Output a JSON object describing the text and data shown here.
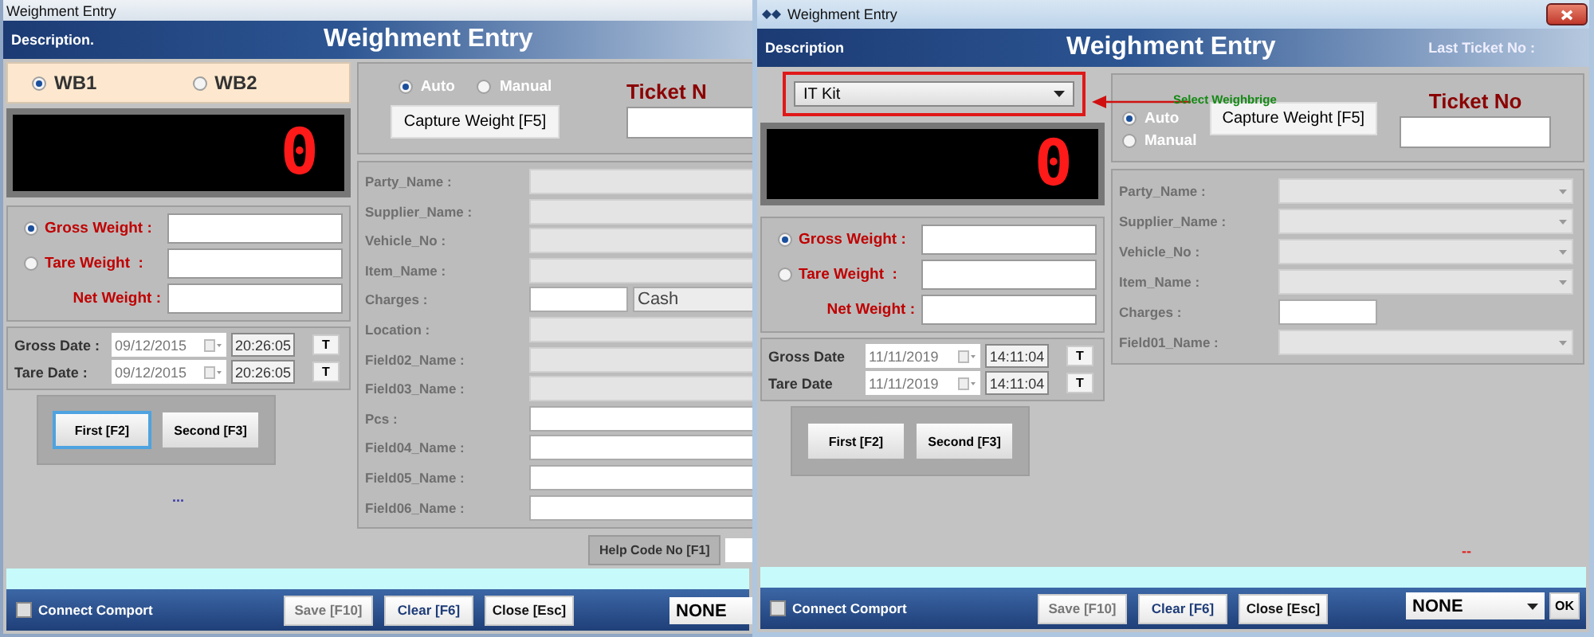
{
  "back_window": {
    "title": "Weighment Entry",
    "header_left": "Description.",
    "header_title": "Weighment Entry",
    "weighbridges": [
      {
        "label": "WB1",
        "selected": true
      },
      {
        "label": "WB2",
        "selected": false
      }
    ],
    "display": "0",
    "modes": [
      {
        "label": "Auto",
        "selected": true
      },
      {
        "label": "Manual",
        "selected": false
      }
    ],
    "capture_button": "Capture Weight [F5]",
    "ticket_label": "Ticket N",
    "weights": [
      {
        "label": "Gross Weight :",
        "kind": "radio",
        "selected": true
      },
      {
        "label": "Tare Weight  :",
        "kind": "radio",
        "selected": false
      },
      {
        "label": "Net Weight :",
        "kind": "plain"
      }
    ],
    "dates": [
      {
        "label": "Gross Date :",
        "date": "09/12/2015",
        "time": "20:26:05",
        "button": "T"
      },
      {
        "label": "Tare Date :",
        "date": "09/12/2015",
        "time": "20:26:05",
        "button": "T"
      }
    ],
    "buttons": [
      {
        "label": "First [F2]",
        "selected": true
      },
      {
        "label": "Second [F3]",
        "selected": false
      }
    ],
    "ellipsis": "...",
    "fields": [
      {
        "label": "Party_Name :",
        "kind": "combo"
      },
      {
        "label": "Supplier_Name :",
        "kind": "combo"
      },
      {
        "label": "Vehicle_No :",
        "kind": "combo"
      },
      {
        "label": "Item_Name :",
        "kind": "combo"
      },
      {
        "label": "Charges :",
        "kind": "charges",
        "value": "Cash"
      },
      {
        "label": "Location :",
        "kind": "combo"
      },
      {
        "label": "Field02_Name :",
        "kind": "combo"
      },
      {
        "label": "Field03_Name :",
        "kind": "combo"
      },
      {
        "label": "Pcs :",
        "kind": "input"
      },
      {
        "label": "Field04_Name :",
        "kind": "input"
      },
      {
        "label": "Field05_Name :",
        "kind": "input"
      },
      {
        "label": "Field06_Name :",
        "kind": "input"
      }
    ],
    "help_code": "Help Code No [F1]",
    "connect_comport": {
      "label": "Connect Comport",
      "checked": false
    },
    "footer_buttons": [
      {
        "label": "Save [F10]",
        "kind": "disabled"
      },
      {
        "label": "Clear [F6]",
        "kind": "link"
      },
      {
        "label": "Close [Esc]",
        "kind": "normal"
      }
    ],
    "port": "NONE"
  },
  "front_window": {
    "title": "Weighment Entry",
    "header_left": "Description",
    "header_title": "Weighment Entry",
    "header_right": "Last Ticket No :",
    "weighbridge": "IT Kit",
    "callout": "Select Weighbrige",
    "display": "0",
    "modes": [
      {
        "label": "Auto",
        "selected": true
      },
      {
        "label": "Manual",
        "selected": false
      }
    ],
    "capture_button": "Capture Weight [F5]",
    "ticket_label": "Ticket No",
    "weights": [
      {
        "label": "Gross Weight :",
        "kind": "radio",
        "selected": true
      },
      {
        "label": "Tare Weight  :",
        "kind": "radio",
        "selected": false
      },
      {
        "label": "Net Weight :",
        "kind": "plain"
      }
    ],
    "dates": [
      {
        "label": "Gross Date",
        "date": "11/11/2019",
        "time": "14:11:04",
        "button": "T"
      },
      {
        "label": "Tare Date",
        "date": "11/11/2019",
        "time": "14:11:04",
        "button": "T"
      }
    ],
    "buttons": [
      {
        "label": "First [F2]",
        "selected": false
      },
      {
        "label": "Second [F3]",
        "selected": false
      }
    ],
    "fields": [
      {
        "label": "Party_Name :",
        "kind": "combo"
      },
      {
        "label": "Supplier_Name :",
        "kind": "combo"
      },
      {
        "label": "Vehicle_No :",
        "kind": "combo"
      },
      {
        "label": "Item_Name :",
        "kind": "combo"
      },
      {
        "label": "Charges :",
        "kind": "small"
      },
      {
        "label": "Field01_Name :",
        "kind": "combo"
      }
    ],
    "status_mark": "--",
    "connect_comport": {
      "label": "Connect Comport",
      "checked": false
    },
    "footer_buttons": [
      {
        "label": "Save [F10]",
        "kind": "disabled"
      },
      {
        "label": "Clear [F6]",
        "kind": "link"
      },
      {
        "label": "Close [Esc]",
        "kind": "normal"
      }
    ],
    "port": "NONE",
    "ok_button": "OK"
  }
}
